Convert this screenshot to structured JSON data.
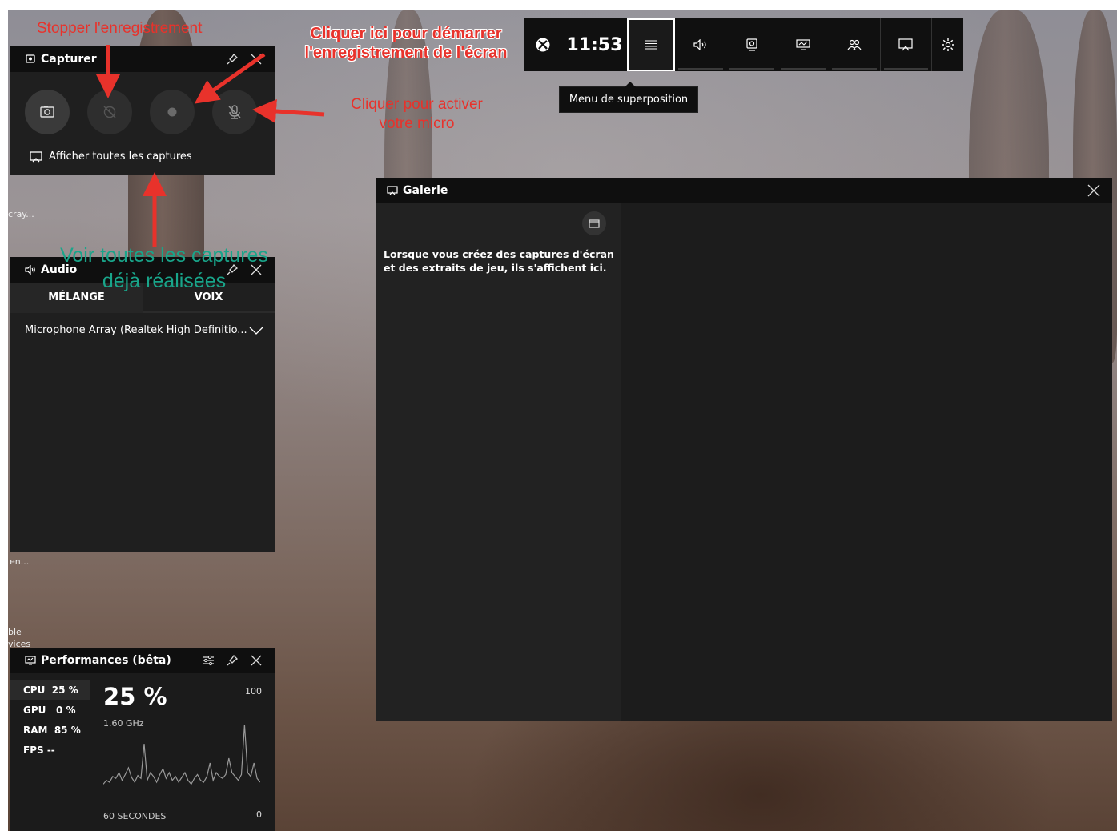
{
  "annotations": {
    "stop_recording": "Stopper l'enregistrement",
    "start_recording_line1": "Cliquer ici pour démarrer",
    "start_recording_line2": "l'enregistrement de l'écran",
    "activate_mic_line1": "Cliquer pour activer",
    "activate_mic_line2": "votre micro",
    "view_captures_line1": "Voir toutes les captures",
    "view_captures_line2": "déjà réalisées"
  },
  "topbar": {
    "time": "11:53",
    "tooltip": "Menu de superposition",
    "icons": [
      "xbox-icon",
      "menu-icon",
      "audio-icon",
      "capture-icon",
      "performance-icon",
      "social-icon",
      "gallery-icon",
      "settings-icon"
    ]
  },
  "capture": {
    "title": "Capturer",
    "show_all": "Afficher toutes les captures"
  },
  "audio": {
    "title": "Audio",
    "tabs": [
      "MÉLANGE",
      "VOIX"
    ],
    "active_tab": "VOIX",
    "device": "Microphone Array (Realtek High Definitio..."
  },
  "performance": {
    "title": "Performances (bêta)",
    "stats": [
      {
        "label": "CPU",
        "value": "25 %"
      },
      {
        "label": "GPU",
        "value": "0 %"
      },
      {
        "label": "RAM",
        "value": "85 %"
      },
      {
        "label": "FPS",
        "value": "--"
      }
    ],
    "big_value": "25 %",
    "frequency": "1.60 GHz",
    "max_label": "100",
    "min_label": "0",
    "time_label": "60 SECONDES",
    "cpu_history": [
      18,
      22,
      20,
      26,
      24,
      30,
      22,
      28,
      35,
      25,
      20,
      27,
      24,
      60,
      22,
      30,
      26,
      20,
      28,
      34,
      24,
      30,
      22,
      26,
      20,
      25,
      30,
      22,
      18,
      24,
      28,
      22,
      20,
      26,
      40,
      22,
      30,
      26,
      24,
      28,
      45,
      30,
      26,
      22,
      28,
      80,
      30,
      26,
      40,
      24,
      20
    ]
  },
  "gallery": {
    "title": "Galerie",
    "empty_text": "Lorsque vous créez des captures d'écran et des extraits de jeu, ils s'affichent ici."
  },
  "desktop": {
    "labels": [
      "cray...",
      "en...",
      "ble",
      "vices"
    ]
  },
  "colors": {
    "annotation_red": "#e8322b",
    "annotation_green": "#19a58a",
    "panel_bg": "#1f1f1f",
    "header_bg": "#0f0f0f"
  }
}
